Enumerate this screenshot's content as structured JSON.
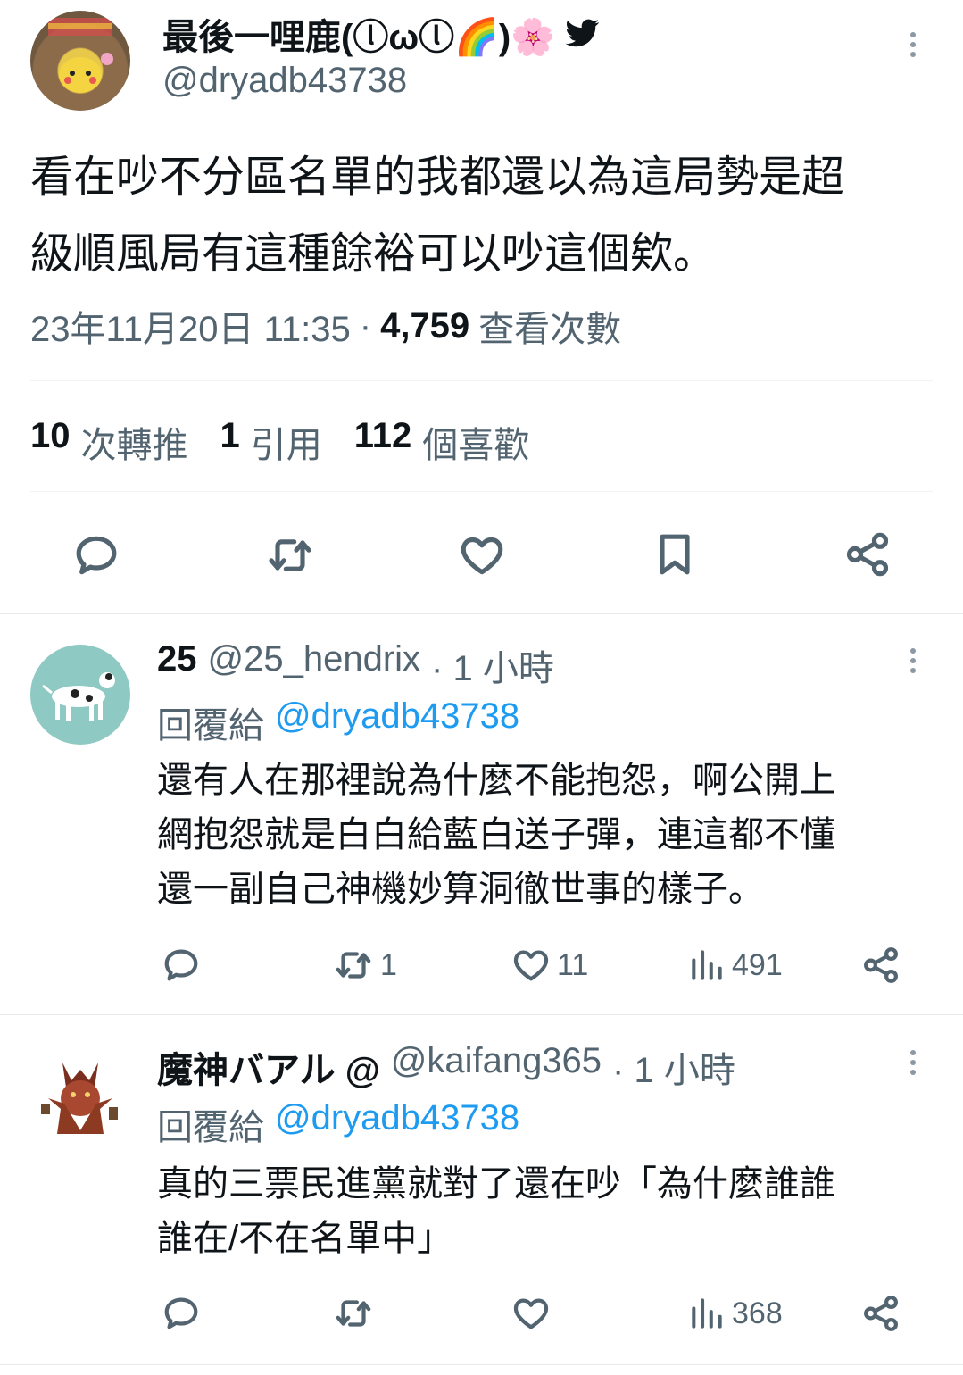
{
  "main_tweet": {
    "display_name": "最後一哩鹿(ⓛωⓛ🌈)🌸",
    "handle": "@dryadb43738",
    "text_line1": "看在吵不分區名單的我都還以為這局勢是超",
    "text_line2": "級順風局有這種餘裕可以吵這個欸。",
    "timestamp": "23年11月20日 11:35",
    "separator": "·",
    "views_count": "4,759",
    "views_label": "查看次數",
    "retweets_count": "10",
    "retweets_label": "次轉推",
    "quotes_count": "1",
    "quotes_label": "引用",
    "likes_count": "112",
    "likes_label": "個喜歡"
  },
  "replies": [
    {
      "display_name": "25",
      "handle": "@25_hendrix",
      "time": "· 1 小時",
      "reply_to_label": "回覆給",
      "reply_to_handle": "@dryadb43738",
      "text_line1": "還有人在那裡說為什麼不能抱怨，啊公開上",
      "text_line2": "網抱怨就是白白給藍白送子彈，連這都不懂",
      "text_line3": "還一副自己神機妙算洞徹世事的樣子。",
      "retweets": "1",
      "likes": "11",
      "views": "491"
    },
    {
      "display_name": "魔神バアル @",
      "handle": "@kaifang365",
      "time": "· 1 小時",
      "reply_to_label": "回覆給",
      "reply_to_handle": "@dryadb43738",
      "text_line1": "真的三票民進黨就對了還在吵「為什麼誰誰",
      "text_line2": "誰在/不在名單中」",
      "views": "368"
    }
  ],
  "icons": {
    "twitter_bird": "twitter-bird-icon",
    "more": "more-icon",
    "reply": "reply-icon",
    "retweet": "retweet-icon",
    "like": "heart-icon",
    "bookmark": "bookmark-icon",
    "share": "share-icon",
    "views": "views-icon"
  },
  "colors": {
    "link": "#1d9bf0",
    "muted": "#536471",
    "text": "#0f1419"
  }
}
